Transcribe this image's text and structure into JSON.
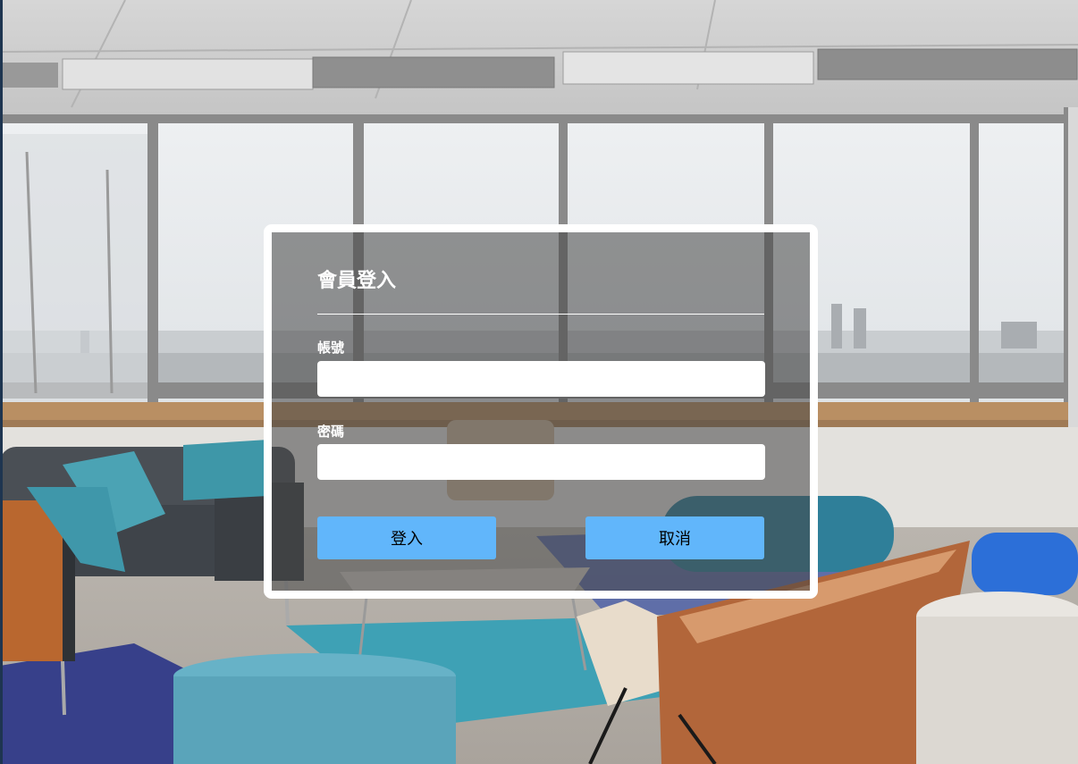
{
  "login": {
    "title": "會員登入",
    "account_label": "帳號",
    "account_value": "",
    "password_label": "密碼",
    "password_value": "",
    "login_button": "登入",
    "cancel_button": "取消"
  },
  "colors": {
    "button": "#61b6fb",
    "card_border": "#ffffff",
    "card_overlay": "rgba(70,70,70,0.55)"
  }
}
